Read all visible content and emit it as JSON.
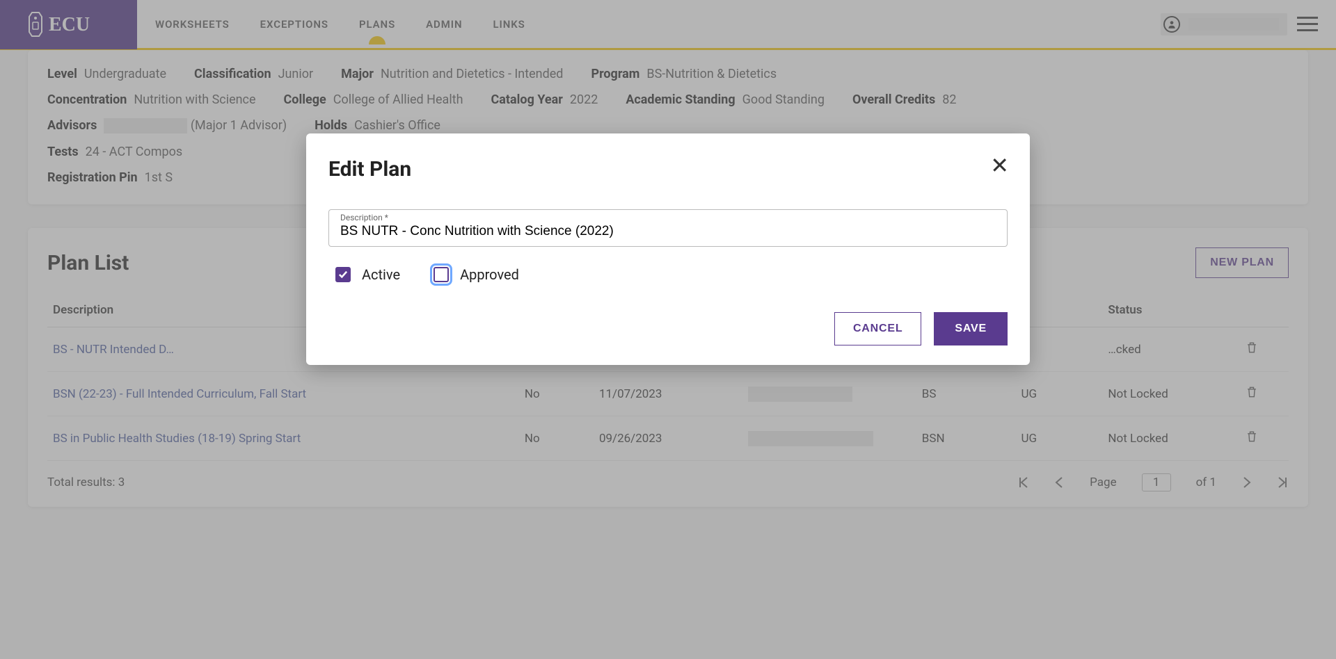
{
  "brand": "ECU",
  "nav": {
    "items": [
      "WORKSHEETS",
      "EXCEPTIONS",
      "PLANS",
      "ADMIN",
      "LINKS"
    ],
    "active_index": 2
  },
  "user_name": "",
  "student": {
    "level": {
      "lab": "Level",
      "val": "Undergraduate"
    },
    "classification": {
      "lab": "Classification",
      "val": "Junior"
    },
    "major": {
      "lab": "Major",
      "val": "Nutrition and Dietetics - Intended"
    },
    "program": {
      "lab": "Program",
      "val": "BS-Nutrition & Dietetics"
    },
    "concentration": {
      "lab": "Concentration",
      "val": "Nutrition with Science"
    },
    "college": {
      "lab": "College",
      "val": "College of Allied Health"
    },
    "catalog_year": {
      "lab": "Catalog Year",
      "val": "2022"
    },
    "academic_standing": {
      "lab": "Academic Standing",
      "val": "Good Standing"
    },
    "overall_credits": {
      "lab": "Overall Credits",
      "val": "82"
    },
    "advisors": {
      "lab": "Advisors",
      "val": "(Major 1 Advisor)"
    },
    "holds": {
      "lab": "Holds",
      "val": "Cashier's Office"
    },
    "tests": {
      "lab": "Tests",
      "val": "24 - ACT Compos"
    },
    "registration_pin": {
      "lab": "Registration Pin",
      "val": "1st S"
    }
  },
  "plan_list": {
    "title": "Plan List",
    "new_plan_label": "NEW PLAN",
    "columns": [
      "Description",
      "",
      "",
      "",
      "",
      "",
      "Status",
      ""
    ],
    "status_header": "Status",
    "desc_header": "Description",
    "rows": [
      {
        "desc": "BS - NUTR Intended D…",
        "active": "",
        "modified": "",
        "who": "",
        "degree": "",
        "level": "",
        "status": "…cked"
      },
      {
        "desc": "BSN (22-23) - Full Intended Curriculum, Fall Start",
        "active": "No",
        "modified": "11/07/2023",
        "who": "",
        "degree": "BS",
        "level": "UG",
        "status": "Not Locked"
      },
      {
        "desc": "BS in Public Health Studies (18-19) Spring Start",
        "active": "No",
        "modified": "09/26/2023",
        "who": "",
        "degree": "BSN",
        "level": "UG",
        "status": "Not Locked"
      }
    ],
    "total": "Total results: 3",
    "page_label": "Page",
    "page_num": "1",
    "of_label": "of 1"
  },
  "modal": {
    "title": "Edit Plan",
    "desc_label": "Description *",
    "desc_value": "BS NUTR - Conc Nutrition with Science (2022)",
    "active_label": "Active",
    "approved_label": "Approved",
    "active_checked": true,
    "approved_checked": false,
    "cancel_label": "CANCEL",
    "save_label": "SAVE"
  }
}
